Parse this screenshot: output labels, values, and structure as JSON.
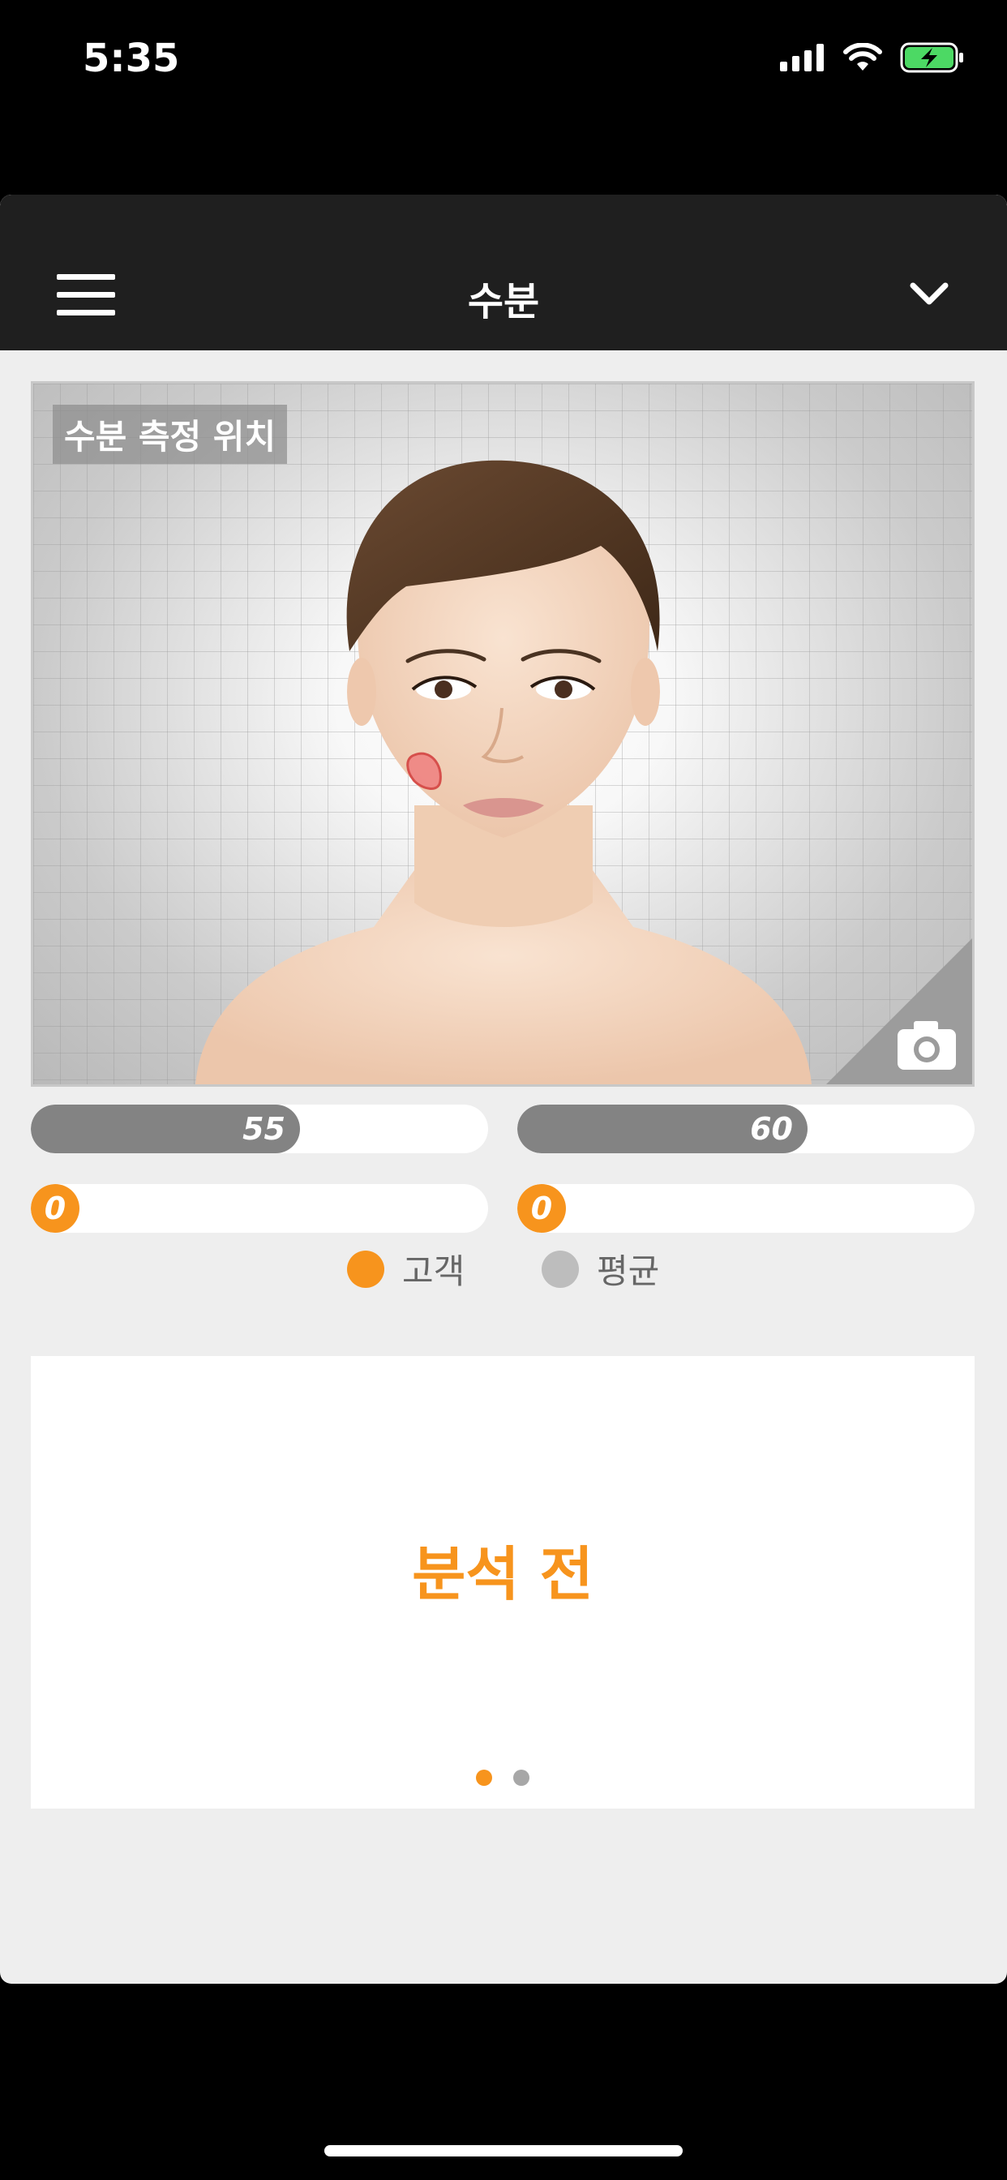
{
  "status_bar": {
    "time": "5:35"
  },
  "header": {
    "title": "수분"
  },
  "face_panel": {
    "location_label": "수분 측정 위치"
  },
  "bars": {
    "left_average": {
      "value": "55",
      "fraction": 0.59
    },
    "right_average": {
      "value": "60",
      "fraction": 0.59
    },
    "left_customer": {
      "value": "0"
    },
    "right_customer": {
      "value": "0"
    }
  },
  "legend": {
    "customer": {
      "label": "고객",
      "color": "#f7941d"
    },
    "average": {
      "label": "평균",
      "color": "#bdbdbd"
    }
  },
  "result": {
    "status": "분석 전"
  },
  "pager": {
    "active_index": 0,
    "count": 2
  },
  "colors": {
    "accent": "#f7941d",
    "topbar": "#1f1f1f",
    "bar_gray": "#838383",
    "background": "#eeeeee"
  }
}
